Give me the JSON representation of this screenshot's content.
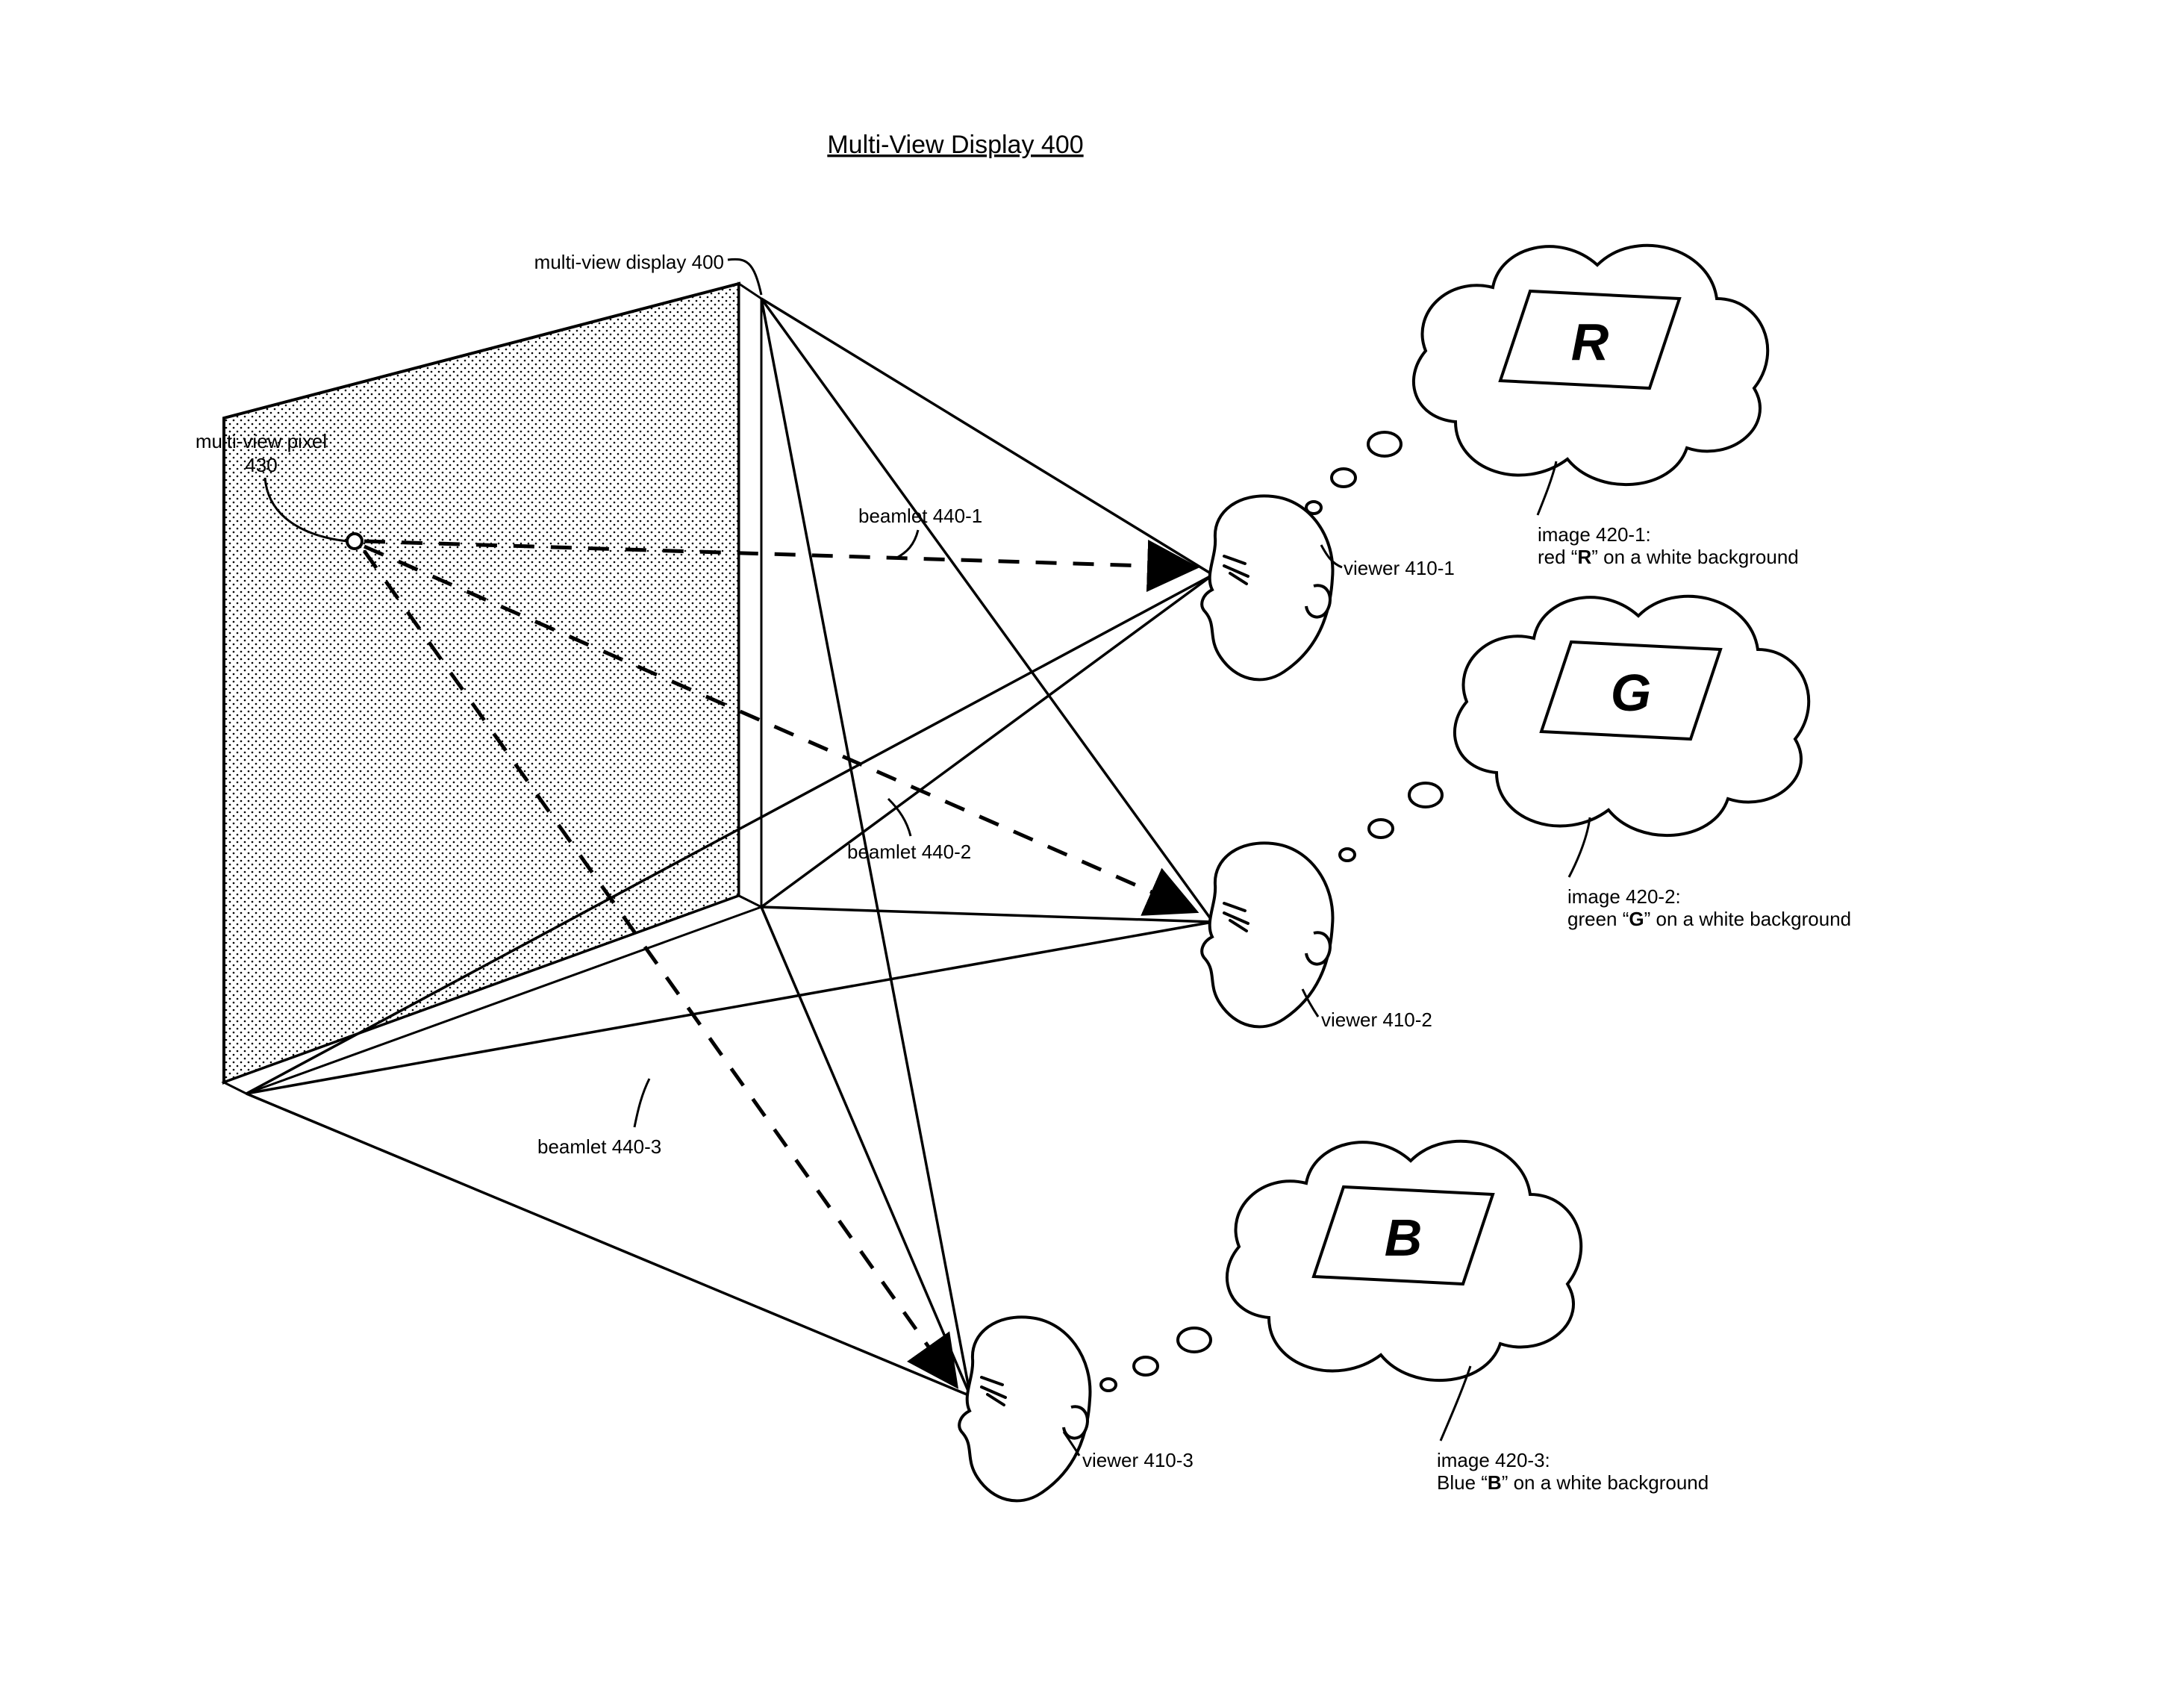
{
  "title": "Multi-View Display 400",
  "displayLabel": "multi-view display 400",
  "pixelLabelLine1": "multi-view pixel",
  "pixelLabelLine2": "430",
  "beamlets": [
    {
      "id": "b1",
      "label": "beamlet 440-1"
    },
    {
      "id": "b2",
      "label": "beamlet 440-2"
    },
    {
      "id": "b3",
      "label": "beamlet 440-3"
    }
  ],
  "viewers": [
    {
      "id": "v1",
      "label": "viewer 410-1"
    },
    {
      "id": "v2",
      "label": "viewer 410-2"
    },
    {
      "id": "v3",
      "label": "viewer 410-3"
    }
  ],
  "images": [
    {
      "id": "i1",
      "letter": "R",
      "line1": "image 420-1:",
      "line2a": "red “",
      "line2b": "R",
      "line2c": "” on a white background"
    },
    {
      "id": "i2",
      "letter": "G",
      "line1": "image 420-2:",
      "line2a": "green “",
      "line2b": "G",
      "line2c": "” on a white background"
    },
    {
      "id": "i3",
      "letter": "B",
      "line1": "image 420-3:",
      "line2a": "Blue “",
      "line2b": "B",
      "line2c": "” on a white background"
    }
  ]
}
